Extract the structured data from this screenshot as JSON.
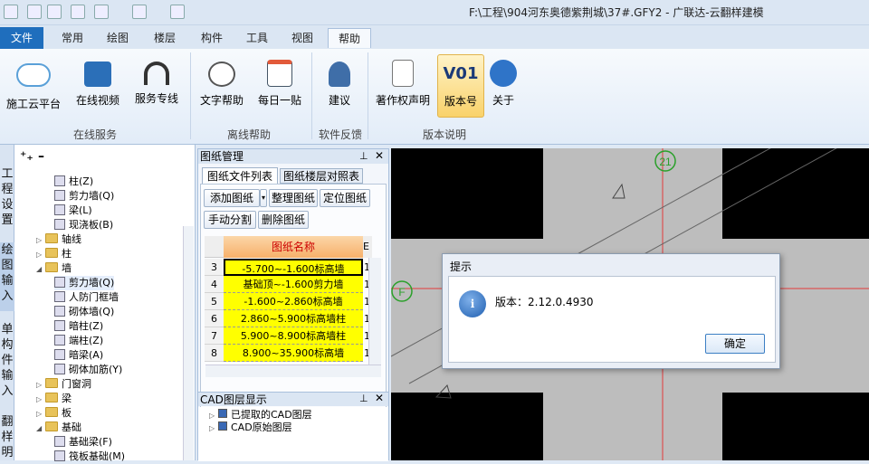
{
  "window": {
    "title": "F:\\工程\\904河东奥德紫荆城\\37#.GFY2 - 广联达-云翻样建模"
  },
  "menu_tabs": [
    "文件",
    "常用",
    "绘图",
    "楼层",
    "构件",
    "工具",
    "视图",
    "帮助"
  ],
  "ribbon": {
    "buttons": [
      {
        "label": "施工云平台",
        "icon": "cloud-icon"
      },
      {
        "label": "在线视频",
        "icon": "video-icon"
      },
      {
        "label": "服务专线",
        "icon": "headset-icon"
      },
      {
        "label": "文字帮助",
        "icon": "help-chat-icon"
      },
      {
        "label": "每日一贴",
        "icon": "daily-tip-icon"
      },
      {
        "label": "建议",
        "icon": "user-suggest-icon"
      },
      {
        "label": "著作权声明",
        "icon": "copyright-doc-icon"
      },
      {
        "label": "版本号",
        "icon": "version-icon"
      },
      {
        "label": "关于",
        "icon": "info-icon"
      }
    ],
    "groups": [
      "在线服务",
      "离线帮助",
      "软件反馈",
      "版本说明"
    ],
    "version_glyph": "V01"
  },
  "left_tabs": [
    "工程设置",
    "绘图输入",
    "单构件输入",
    "翻样明"
  ],
  "tree": {
    "items": [
      "柱(Z)",
      "剪力墙(Q)",
      "梁(L)",
      "现浇板(B)",
      "轴线",
      "柱",
      "墙",
      "剪力墙(Q)",
      "人防门框墙",
      "砌体墙(Q)",
      "暗柱(Z)",
      "端柱(Z)",
      "暗梁(A)",
      "砌体加筋(Y)",
      "门窗洞",
      "梁",
      "板",
      "基础",
      "基础梁(F)",
      "筏板基础(M)"
    ]
  },
  "drawing_panel": {
    "title": "图纸管理",
    "tabs": [
      "图纸文件列表",
      "图纸楼层对照表"
    ],
    "buttons": [
      "添加图纸",
      "整理图纸",
      "定位图纸",
      "手动分割",
      "删除图纸"
    ],
    "column_header": "图纸名称",
    "rows": [
      {
        "num": "3",
        "name": "-5.700~-1.600标高墙",
        "extra": "1"
      },
      {
        "num": "4",
        "name": "基础顶~-1.600剪力墙",
        "extra": "1"
      },
      {
        "num": "5",
        "name": "-1.600~2.860标高墙",
        "extra": "1"
      },
      {
        "num": "6",
        "name": "2.860~5.900标高墙柱",
        "extra": "1"
      },
      {
        "num": "7",
        "name": "5.900~8.900标高墙柱",
        "extra": "1"
      },
      {
        "num": "8",
        "name": "8.900~35.900标高墙",
        "extra": "1"
      }
    ]
  },
  "cad_panel": {
    "title": "CAD图层显示",
    "layers": [
      "已提取的CAD图层",
      "CAD原始图层"
    ]
  },
  "canvas": {
    "axis_labels": [
      "21",
      "F"
    ]
  },
  "dialog": {
    "title": "提示",
    "message": "版本：2.12.0.4930",
    "ok_label": "确定"
  }
}
